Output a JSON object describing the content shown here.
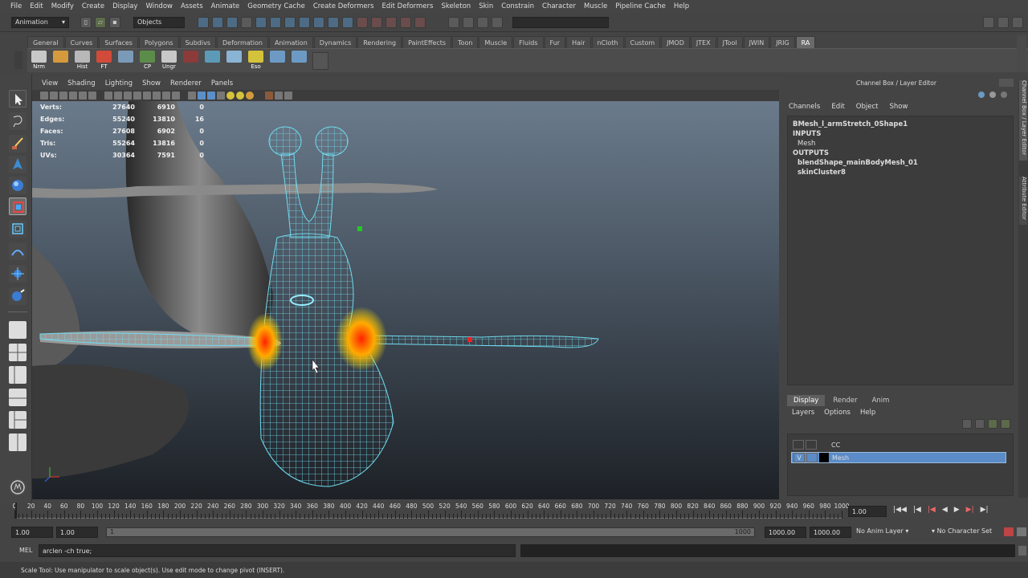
{
  "menubar": [
    "File",
    "Edit",
    "Modify",
    "Create",
    "Display",
    "Window",
    "Assets",
    "Animate",
    "Geometry Cache",
    "Create Deformers",
    "Edit Deformers",
    "Skeleton",
    "Skin",
    "Constrain",
    "Character",
    "Muscle",
    "Pipeline Cache",
    "Help"
  ],
  "statusline": {
    "mode": "Animation",
    "selection": "Objects"
  },
  "shelf_tabs": [
    "General",
    "Curves",
    "Surfaces",
    "Polygons",
    "Subdivs",
    "Deformation",
    "Animation",
    "Dynamics",
    "Rendering",
    "PaintEffects",
    "Toon",
    "Muscle",
    "Fluids",
    "Fur",
    "Hair",
    "nCloth",
    "Custom",
    "JMOD",
    "JTEX",
    "JTool",
    "JWIN",
    "JRIG",
    "RA"
  ],
  "shelf_active": "RA",
  "shelf_buttons": [
    {
      "label": "Nrm",
      "color": "#c8c8c8"
    },
    {
      "label": "",
      "color": "#d49a3b"
    },
    {
      "label": "Hist",
      "color": "#b8b8b8"
    },
    {
      "label": "FT",
      "color": "#d24a3a"
    },
    {
      "label": "",
      "color": "#7a9ab8"
    },
    {
      "label": "CP",
      "color": "#5c8c4a"
    },
    {
      "label": "Ungr",
      "color": "#c8c8c8"
    },
    {
      "label": "",
      "color": "#8c3a3a"
    },
    {
      "label": "",
      "color": "#5c9ab8"
    },
    {
      "label": "",
      "color": "#8ab4d4"
    },
    {
      "label": "Eso",
      "color": "#d4c23a"
    },
    {
      "label": "",
      "color": "#6c9ac4"
    },
    {
      "label": "",
      "color": "#6c9ac4"
    }
  ],
  "viewport": {
    "menu": [
      "View",
      "Shading",
      "Lighting",
      "Show",
      "Renderer",
      "Panels"
    ],
    "hud": [
      {
        "label": "Verts:",
        "c1": "27640",
        "c2": "6910",
        "c3": "0"
      },
      {
        "label": "Edges:",
        "c1": "55240",
        "c2": "13810",
        "c3": "16"
      },
      {
        "label": "Faces:",
        "c1": "27608",
        "c2": "6902",
        "c3": "0"
      },
      {
        "label": "Tris:",
        "c1": "55264",
        "c2": "13816",
        "c3": "0"
      },
      {
        "label": "UVs:",
        "c1": "30364",
        "c2": "7591",
        "c3": "0"
      }
    ]
  },
  "channel_box": {
    "title": "Channel Box / Layer Editor",
    "menu": [
      "Channels",
      "Edit",
      "Object",
      "Show"
    ],
    "node": "BMesh_l_armStretch_0Shape1",
    "inputs_label": "INPUTS",
    "inputs": [
      "Mesh"
    ],
    "outputs_label": "OUTPUTS",
    "outputs": [
      "blendShape_mainBodyMesh_01",
      "skinCluster8"
    ]
  },
  "layer_editor": {
    "tabs": [
      "Display",
      "Render",
      "Anim"
    ],
    "active_tab": "Display",
    "menu": [
      "Layers",
      "Options",
      "Help"
    ],
    "layers": [
      {
        "name": "CC",
        "vis": "",
        "selected": false
      },
      {
        "name": "Mesh",
        "vis": "V",
        "selected": true
      }
    ]
  },
  "timeline": {
    "tick_labels": [
      "0",
      "20",
      "40",
      "60",
      "80",
      "100",
      "120",
      "140",
      "160",
      "180",
      "200",
      "220",
      "240",
      "260",
      "280",
      "300",
      "320",
      "340",
      "360",
      "380",
      "400",
      "420",
      "440",
      "460",
      "480",
      "500",
      "520",
      "540",
      "560",
      "580",
      "600",
      "620",
      "640",
      "660",
      "680",
      "700",
      "720",
      "740",
      "760",
      "780",
      "800",
      "820",
      "840",
      "860",
      "880",
      "900",
      "920",
      "940",
      "960",
      "980",
      "1000"
    ],
    "current_frame": "1.00"
  },
  "range": {
    "start": "1.00",
    "playback_start": "1.00",
    "slider_start": "1",
    "slider_end": "1000",
    "playback_end": "1000.00",
    "end": "1000.00",
    "anim_layer": "No Anim Layer",
    "character_set": "No Character Set"
  },
  "command_line": {
    "label": "MEL",
    "value": "arclen -ch true;"
  },
  "help_line": "Scale Tool: Use manipulator to scale object(s). Use edit mode to change pivot (INSERT).",
  "colors": {
    "wire": "#6fdcf0",
    "selected_layer": "#5b8cc8",
    "bg": "#444444"
  }
}
